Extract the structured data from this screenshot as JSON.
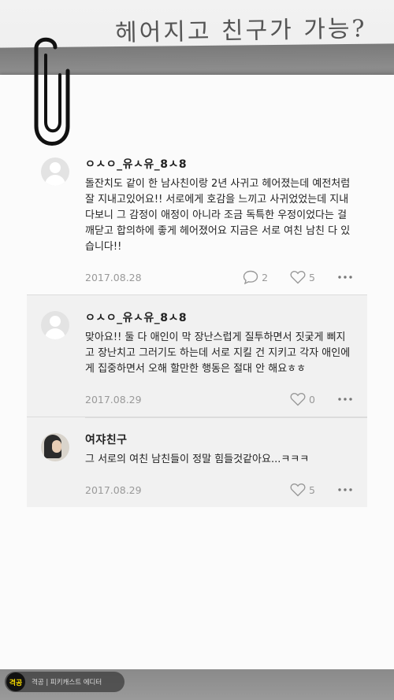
{
  "header": {
    "title": "헤어지고 친구가 가능?"
  },
  "comments": [
    {
      "author": "ㅇㅅㅇ_유ㅅ유_8ㅅ8",
      "text": "돌잔치도 같이 한 남사친이랑 2년 사귀고 헤어졌는데 예전처럼 잘 지내고있어요!! 서로에게 호감을 느끼고 사귀었었는데 지내다보니 그 감정이 애정이 아니라 조금 독특한 우정이었다는 걸 깨닫고 합의하에 좋게 헤어졌어요 지금은 서로 여친 남친 다 있습니다!!",
      "date": "2017.08.28",
      "replies": "2",
      "likes": "5"
    },
    {
      "author": "ㅇㅅㅇ_유ㅅ유_8ㅅ8",
      "text": "맞아요!! 둘 다 애인이 막 장난스럽게 질투하면서 짓궂게 삐지고 장난치고 그러기도 하는데 서로 지킬 건 지키고 각자 애인에게 집중하면서 오해 할만한 행동은 절대 안 해요ㅎㅎ",
      "date": "2017.08.29",
      "likes": "0"
    },
    {
      "author": "여쟈친구",
      "text": "그 서로의 여친 남친들이 정말 힘들것같아요...ㅋㅋㅋ",
      "date": "2017.08.29",
      "likes": "5"
    }
  ],
  "footer": {
    "logo": "격공",
    "caption": "격공 | 피키캐스트 에디터"
  },
  "colors": {
    "logo_text": "#f2d600",
    "meta": "#999999"
  }
}
